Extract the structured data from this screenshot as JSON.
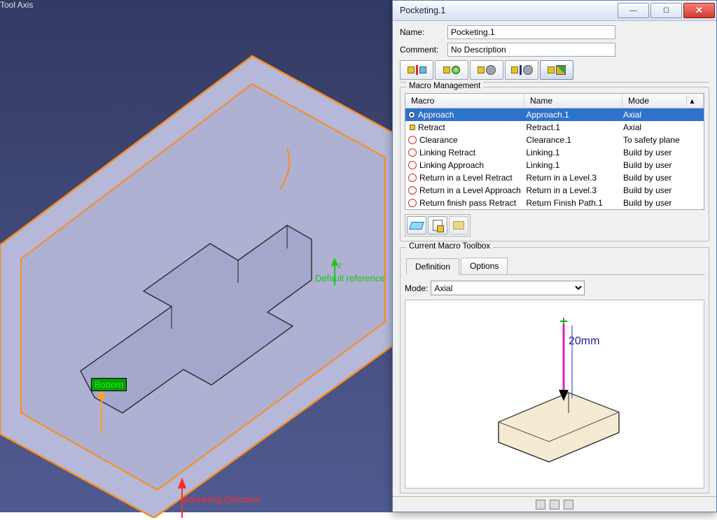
{
  "dialog": {
    "title": "Pocketing.1",
    "name_label": "Name:",
    "name_value": "Pocketing.1",
    "comment_label": "Comment:",
    "comment_value": "No Description"
  },
  "macro_group": {
    "legend": "Macro Management",
    "headers": {
      "macro": "Macro",
      "name": "Name",
      "mode": "Mode"
    },
    "rows": [
      {
        "macro": "Approach",
        "name": "Approach.1",
        "mode": "Axial",
        "selected": true,
        "icon": "radio-on"
      },
      {
        "macro": "Retract",
        "name": "Retract.1",
        "mode": "Axial",
        "selected": false,
        "icon": "ysq"
      },
      {
        "macro": "Clearance",
        "name": "Clearance.1",
        "mode": "To safety plane",
        "selected": false,
        "icon": "ring"
      },
      {
        "macro": "Linking Retract",
        "name": "Linking.1",
        "mode": "Build by user",
        "selected": false,
        "icon": "ring"
      },
      {
        "macro": "Linking Approach",
        "name": "Linking.1",
        "mode": "Build by user",
        "selected": false,
        "icon": "ring"
      },
      {
        "macro": "Return in a Level Retract",
        "name": "Return in a Level.3",
        "mode": "Build by user",
        "selected": false,
        "icon": "ring"
      },
      {
        "macro": "Return in a Level Approach",
        "name": "Return in a Level.3",
        "mode": "Build by user",
        "selected": false,
        "icon": "ring"
      },
      {
        "macro": "Return finish pass Retract",
        "name": "Return Finish Path.1",
        "mode": "Build by user",
        "selected": false,
        "icon": "ring"
      }
    ]
  },
  "toolbox": {
    "legend": "Current Macro Toolbox",
    "tabs": {
      "def": "Definition",
      "opt": "Options"
    },
    "mode_label": "Mode:",
    "mode_value": "Axial",
    "dimension": "20mm"
  },
  "viewport": {
    "bottom": "Bottom",
    "tool_axis": "Tool Axis",
    "default_ref": "Default reference",
    "z": "z",
    "machining_dir": "Machining Direction"
  }
}
